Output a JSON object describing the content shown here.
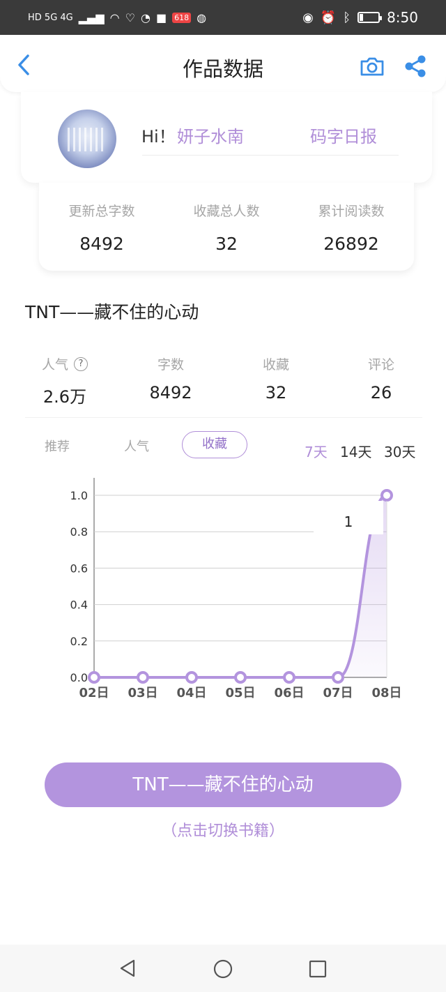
{
  "status_bar": {
    "left_icons": [
      "HD",
      "5G",
      "signal-icon",
      "4G",
      "signal-icon",
      "wifi-icon",
      "heart-icon",
      "wechat-icon",
      "app-icon",
      "app-618-icon",
      "browser-icon"
    ],
    "left_text": "HD 5G 4G",
    "badge_618": "618",
    "time": "8:50",
    "battery_level": 0.2
  },
  "nav": {
    "title": "作品数据"
  },
  "profile": {
    "greeting": "Hi！",
    "username": "妍子水南",
    "daily_link": "码字日报"
  },
  "totals": [
    {
      "label": "更新总字数",
      "value": "8492"
    },
    {
      "label": "收藏总人数",
      "value": "32"
    },
    {
      "label": "累计阅读数",
      "value": "26892"
    }
  ],
  "book": {
    "title": "TNT——藏不住的心动"
  },
  "metrics": [
    {
      "label": "人气",
      "value": "2.6万"
    },
    {
      "label": "字数",
      "value": "8492"
    },
    {
      "label": "收藏",
      "value": "32"
    },
    {
      "label": "评论",
      "value": "26"
    }
  ],
  "tabs": {
    "recommend": "推荐",
    "popularity": "人气",
    "favorites": "收藏",
    "selected": "收藏"
  },
  "ranges": {
    "d7": "7天",
    "d14": "14天",
    "d30": "30天",
    "selected": "7天"
  },
  "chart_data": {
    "type": "area",
    "categories": [
      "02日",
      "03日",
      "04日",
      "05日",
      "06日",
      "07日",
      "08日"
    ],
    "values": [
      0,
      0,
      0,
      0,
      0,
      0,
      1
    ],
    "y_ticks": [
      "0.0",
      "0.2",
      "0.4",
      "0.6",
      "0.8",
      "1.0"
    ],
    "ylim": [
      0,
      1
    ],
    "grid": true,
    "tooltip": "1",
    "color": "#b394de"
  },
  "actions": {
    "switch_book_label": "TNT——藏不住的心动",
    "switch_hint": "（点击切换书籍）"
  },
  "colors": {
    "accent": "#b08ed8",
    "button": "#b394de",
    "nav_icon": "#3a8ee6"
  }
}
